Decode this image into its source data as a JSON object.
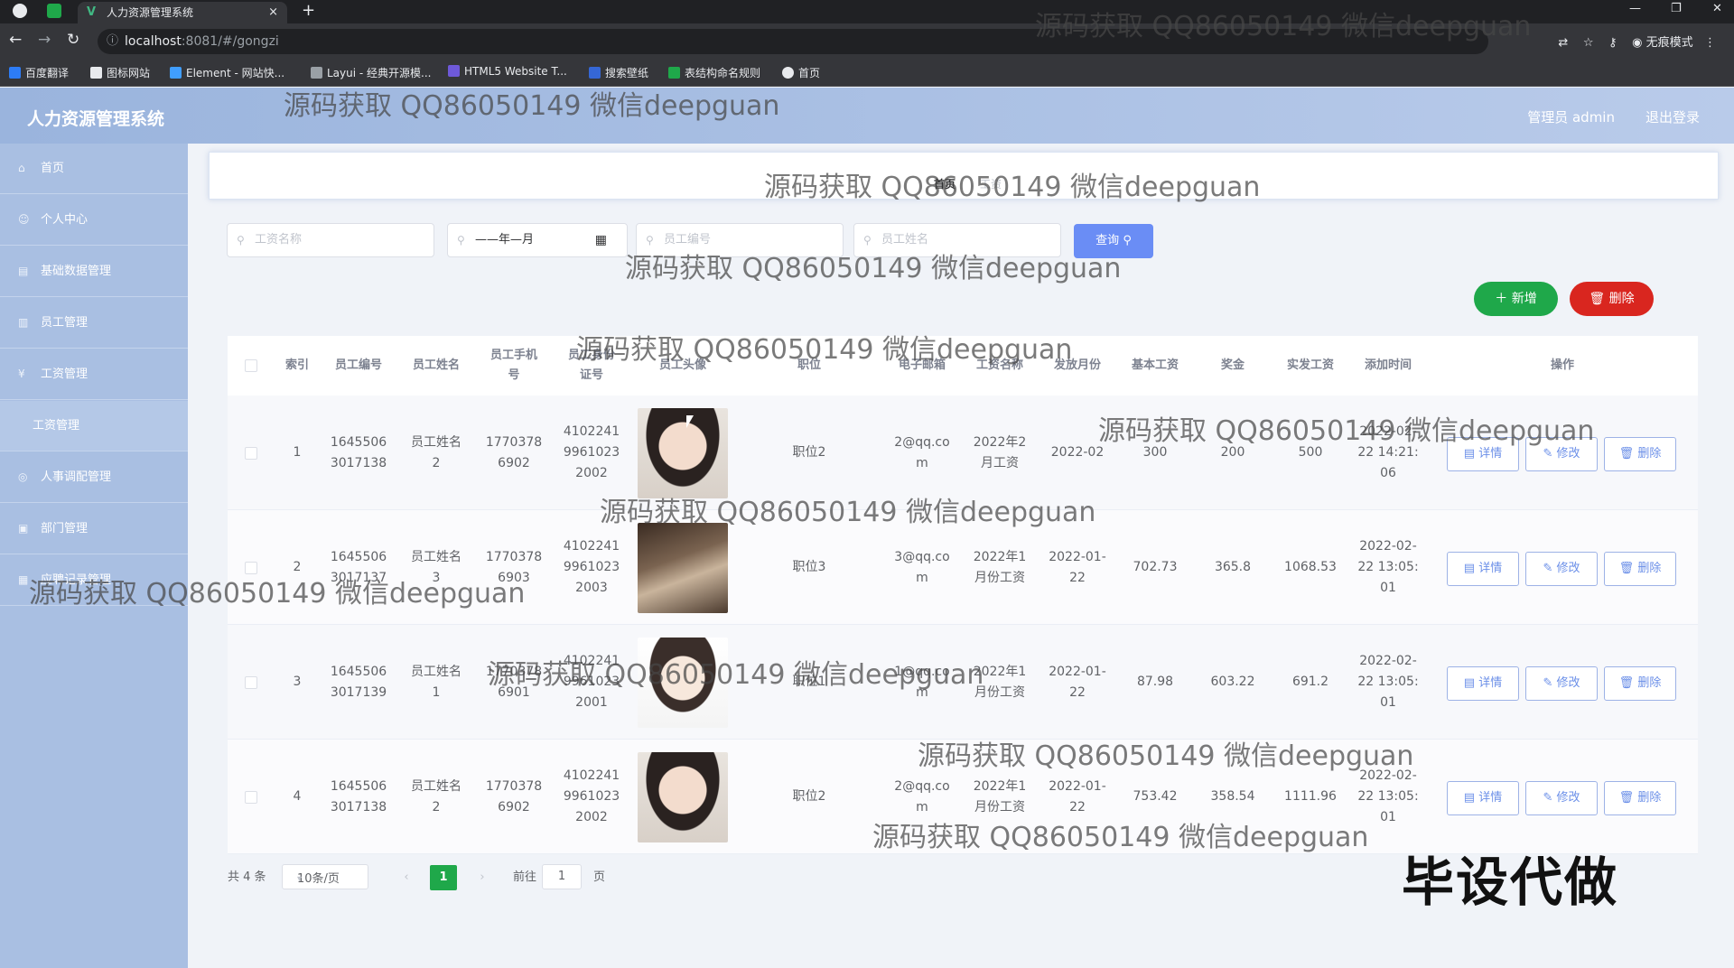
{
  "browser": {
    "tab_title": "人力资源管理系统",
    "tab_close": "×",
    "new_tab": "+",
    "url_host": "localhost",
    "url_path": ":8081/#/gongzi",
    "incognito_label": "无痕模式",
    "bookmarks": [
      "百度翻译",
      "图标网站",
      "Element - 网站快...",
      "Layui - 经典开源模...",
      "HTML5 Website T...",
      "搜索壁纸",
      "表结构命名规则",
      "首页"
    ]
  },
  "header": {
    "title": "人力资源管理系统",
    "user": "管理员 admin",
    "logout": "退出登录"
  },
  "sidebar": {
    "items": [
      {
        "label": "首页"
      },
      {
        "label": "个人中心"
      },
      {
        "label": "基础数据管理"
      },
      {
        "label": "员工管理"
      },
      {
        "label": "工资管理"
      },
      {
        "label": "工资管理"
      },
      {
        "label": "人事调配管理"
      },
      {
        "label": "部门管理"
      },
      {
        "label": "应聘记录管理"
      }
    ]
  },
  "breadcrumb": {
    "home": "首页",
    "current": "工资"
  },
  "filters": {
    "salary_name_placeholder": "工资名称",
    "month_value": "——年—月",
    "employee_no_placeholder": "员工编号",
    "employee_name_placeholder": "员工姓名",
    "query_label": "查询"
  },
  "actions": {
    "add": "新增",
    "delete": "删除"
  },
  "table": {
    "headers": [
      "索引",
      "员工编号",
      "员工姓名",
      "员工手机\n号",
      "员工身份\n证号",
      "员工头像",
      "职位",
      "电子邮箱",
      "工资名称",
      "发放月份",
      "基本工资",
      "奖金",
      "实发工资",
      "添加时间",
      "操作"
    ],
    "rows": [
      {
        "index": "1",
        "emp_no": "1645506\n3017138",
        "name": "员工姓名\n2",
        "phone": "1770378\n6902",
        "id_card": "4102241\n9961023\n2002",
        "position": "职位2",
        "email": "2@qq.co\nm",
        "salary_name": "2022年2\n月工资",
        "month": "2022-02",
        "base": "300",
        "bonus": "200",
        "actual": "500",
        "time": "2022-02-\n22 14:21:\n06"
      },
      {
        "index": "2",
        "emp_no": "1645506\n3017137",
        "name": "员工姓名\n3",
        "phone": "1770378\n6903",
        "id_card": "4102241\n9961023\n2003",
        "position": "职位3",
        "email": "3@qq.co\nm",
        "salary_name": "2022年1\n月份工资",
        "month": "2022-01-\n22",
        "base": "702.73",
        "bonus": "365.8",
        "actual": "1068.53",
        "time": "2022-02-\n22 13:05:\n01"
      },
      {
        "index": "3",
        "emp_no": "1645506\n3017139",
        "name": "员工姓名\n1",
        "phone": "1770378\n6901",
        "id_card": "4102241\n9961023\n2001",
        "position": "职位1",
        "email": "1@qq.co\nm",
        "salary_name": "2022年1\n月份工资",
        "month": "2022-01-\n22",
        "base": "87.98",
        "bonus": "603.22",
        "actual": "691.2",
        "time": "2022-02-\n22 13:05:\n01"
      },
      {
        "index": "4",
        "emp_no": "1645506\n3017138",
        "name": "员工姓名\n2",
        "phone": "1770378\n6902",
        "id_card": "4102241\n9961023\n2002",
        "position": "职位2",
        "email": "2@qq.co\nm",
        "salary_name": "2022年1\n月份工资",
        "month": "2022-01-\n22",
        "base": "753.42",
        "bonus": "358.54",
        "actual": "1111.96",
        "time": "2022-02-\n22 13:05:\n01"
      }
    ],
    "op_detail": "详情",
    "op_edit": "修改",
    "op_delete": "删除"
  },
  "pager": {
    "total": "共 4 条",
    "page_size": "10条/页",
    "current": "1",
    "goto_prefix": "前往",
    "goto_value": "1",
    "goto_suffix": "页"
  },
  "watermark": "源码获取 QQ86050149 微信deepguan",
  "stamp": "毕设代做",
  "colors": {
    "accent": "#6a8df5",
    "sidebar": "#a9bfe2",
    "add": "#1fa84a",
    "danger": "#d9261f"
  }
}
